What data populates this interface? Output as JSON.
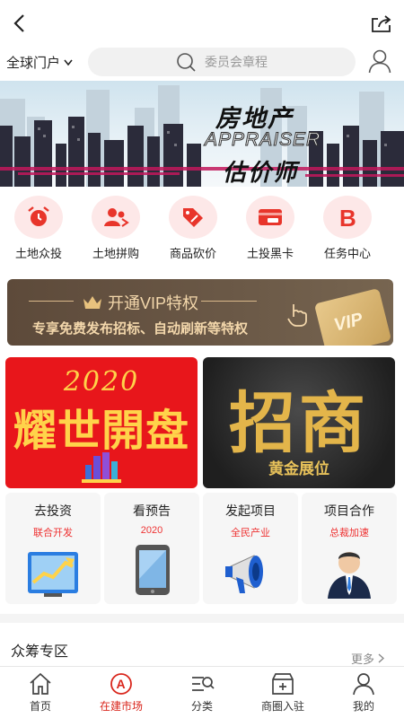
{
  "header": {
    "back_icon": "chevron-left-icon",
    "share_icon": "share-icon"
  },
  "search_bar": {
    "region": "全球门户",
    "placeholder": "委员会章程",
    "user_icon": "user-icon"
  },
  "banner": {
    "line1": "房地产",
    "line2": "APPRAISER",
    "line3": "估价师"
  },
  "categories": [
    {
      "label": "土地众投",
      "icon": "alarm-clock-icon"
    },
    {
      "label": "土地拼购",
      "icon": "group-icon"
    },
    {
      "label": "商品砍价",
      "icon": "price-tag-icon"
    },
    {
      "label": "土投黑卡",
      "icon": "vip-card-icon"
    },
    {
      "label": "任务中心",
      "icon": "b-letter-icon"
    }
  ],
  "vip_banner": {
    "title": "开通VIP特权",
    "description": "专享免费发布招标、自动刷新等特权",
    "card_text": "VIP"
  },
  "promo": {
    "left": {
      "year": "2020",
      "headline": "耀世開盘"
    },
    "right": {
      "headline": "招商",
      "subtitle": "黄金展位"
    }
  },
  "tiles": [
    {
      "title": "去投资",
      "subtitle": "联合开发",
      "icon": "investment-chart-icon"
    },
    {
      "title": "看预告",
      "subtitle": "2020",
      "icon": "tablet-icon"
    },
    {
      "title": "发起项目",
      "subtitle": "全民产业",
      "icon": "megaphone-icon"
    },
    {
      "title": "项目合作",
      "subtitle": "总裁加速",
      "icon": "businessman-icon"
    }
  ],
  "section": {
    "title": "众筹专区",
    "more": "更多"
  },
  "tabbar": [
    {
      "label": "首页",
      "icon": "home-icon",
      "active": false
    },
    {
      "label": "在建市场",
      "icon": "market-icon",
      "active": true
    },
    {
      "label": "分类",
      "icon": "category-search-icon",
      "active": false
    },
    {
      "label": "商圈入驻",
      "icon": "store-add-icon",
      "active": false
    },
    {
      "label": "我的",
      "icon": "user-icon",
      "active": false
    }
  ],
  "colors": {
    "accent": "#d9261c",
    "vip_bg": "#5d4a3a",
    "vip_text": "#f3d7ab",
    "promo_red": "#e8161b",
    "gold": "#ffd34a"
  }
}
